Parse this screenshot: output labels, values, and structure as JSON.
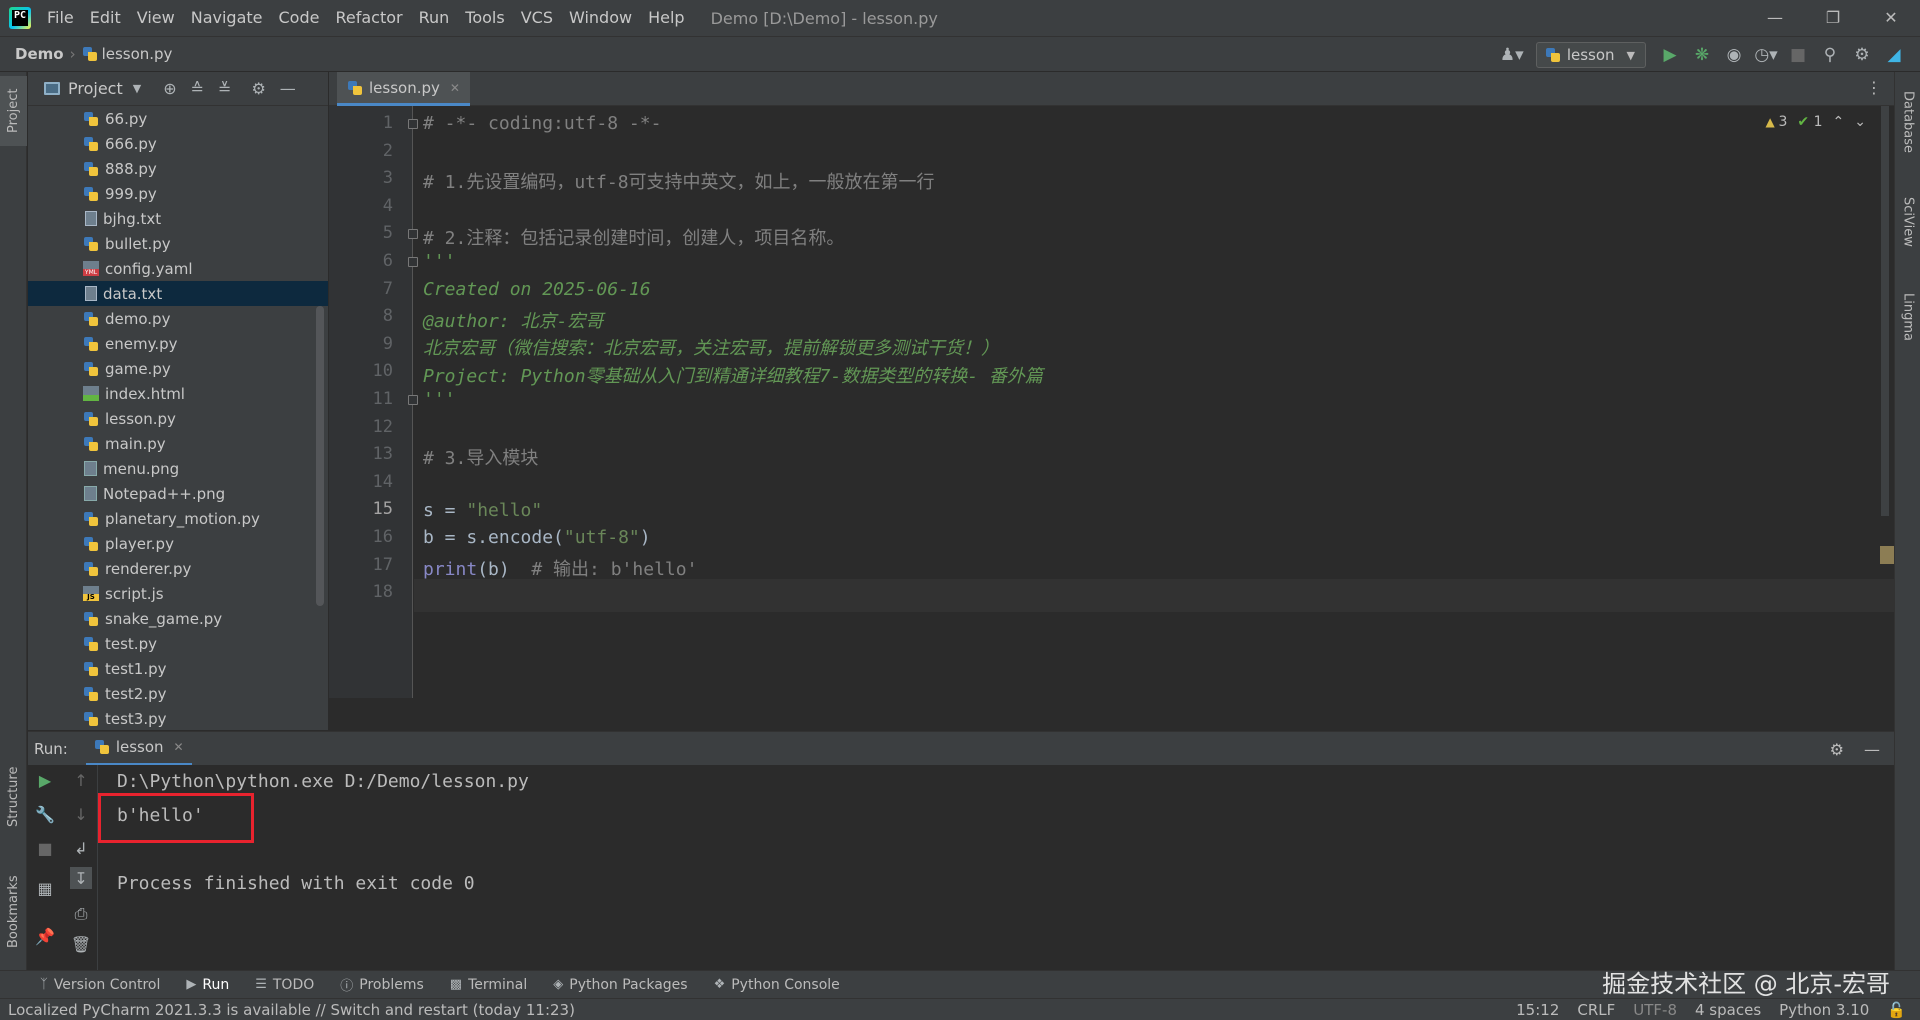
{
  "menubar": {
    "items": [
      "File",
      "Edit",
      "View",
      "Navigate",
      "Code",
      "Refactor",
      "Run",
      "Tools",
      "VCS",
      "Window",
      "Help"
    ],
    "window_title": "Demo [D:\\Demo] - lesson.py"
  },
  "navbar": {
    "project": "Demo",
    "file": "lesson.py",
    "run_config": "lesson"
  },
  "project_panel": {
    "title": "Project",
    "files": [
      {
        "name": "66.py",
        "type": "py"
      },
      {
        "name": "666.py",
        "type": "py"
      },
      {
        "name": "888.py",
        "type": "py"
      },
      {
        "name": "999.py",
        "type": "py"
      },
      {
        "name": "bjhg.txt",
        "type": "txt"
      },
      {
        "name": "bullet.py",
        "type": "py"
      },
      {
        "name": "config.yaml",
        "type": "yml"
      },
      {
        "name": "data.txt",
        "type": "txt",
        "selected": true
      },
      {
        "name": "demo.py",
        "type": "py"
      },
      {
        "name": "enemy.py",
        "type": "py"
      },
      {
        "name": "game.py",
        "type": "py"
      },
      {
        "name": "index.html",
        "type": "html"
      },
      {
        "name": "lesson.py",
        "type": "py"
      },
      {
        "name": "main.py",
        "type": "py"
      },
      {
        "name": "menu.png",
        "type": "img"
      },
      {
        "name": "Notepad++.png",
        "type": "img"
      },
      {
        "name": "planetary_motion.py",
        "type": "py"
      },
      {
        "name": "player.py",
        "type": "py"
      },
      {
        "name": "renderer.py",
        "type": "py"
      },
      {
        "name": "script.js",
        "type": "js"
      },
      {
        "name": "snake_game.py",
        "type": "py"
      },
      {
        "name": "test.py",
        "type": "py"
      },
      {
        "name": "test1.py",
        "type": "py"
      },
      {
        "name": "test2.py",
        "type": "py"
      },
      {
        "name": "test3.py",
        "type": "py"
      }
    ]
  },
  "editor": {
    "tab": "lesson.py",
    "warnings": "3",
    "ok": "1",
    "line_numbers": [
      "1",
      "2",
      "3",
      "4",
      "5",
      "6",
      "7",
      "8",
      "9",
      "10",
      "11",
      "12",
      "13",
      "14",
      "15",
      "16",
      "17",
      "18"
    ],
    "current_line": "15",
    "lines": {
      "l1": "# -*- coding:utf-8 -*-",
      "l3": "# 1.先设置编码，utf-8可支持中英文，如上，一般放在第一行",
      "l5": "# 2.注释：包括记录创建时间，创建人，项目名称。",
      "l6": "'''",
      "l7": "Created on 2025-06-16",
      "l8": "@author: 北京-宏哥",
      "l9": "北京宏哥（微信搜索：北京宏哥，关注宏哥，提前解锁更多测试干货！）",
      "l10": "Project: Python零基础从入门到精通详细教程7-数据类型的转换- 番外篇",
      "l11": "'''",
      "l13": "# 3.导入模块",
      "l15a": "s = ",
      "l15b": "\"hello\"",
      "l16a": "b = s.encode(",
      "l16b": "\"utf-8\"",
      "l16c": ")",
      "l17a": "print",
      "l17b": "(b)  ",
      "l17c": "# 输出: b'hello'"
    }
  },
  "run_panel": {
    "label": "Run:",
    "tab": "lesson",
    "console": {
      "cmd": "D:\\Python\\python.exe D:/Demo/lesson.py",
      "output": "b'hello'",
      "exit": "Process finished with exit code 0"
    }
  },
  "tool_tabs": [
    "Version Control",
    "Run",
    "TODO",
    "Problems",
    "Terminal",
    "Python Packages",
    "Python Console"
  ],
  "left_stripe": {
    "project": "Project",
    "structure": "Structure",
    "bookmarks": "Bookmarks"
  },
  "right_stripe": {
    "database": "Database",
    "sciview": "SciView",
    "lingma": "Lingma"
  },
  "watermark": "掘金技术社区 @ 北京-宏哥",
  "statusbar": {
    "message": "Localized PyCharm 2021.3.3 is available // Switch and restart (today 11:23)",
    "position": "15:12",
    "line_sep": "CRLF",
    "encoding": "UTF-8",
    "indent": "4 spaces",
    "interpreter": "Python 3.10"
  }
}
